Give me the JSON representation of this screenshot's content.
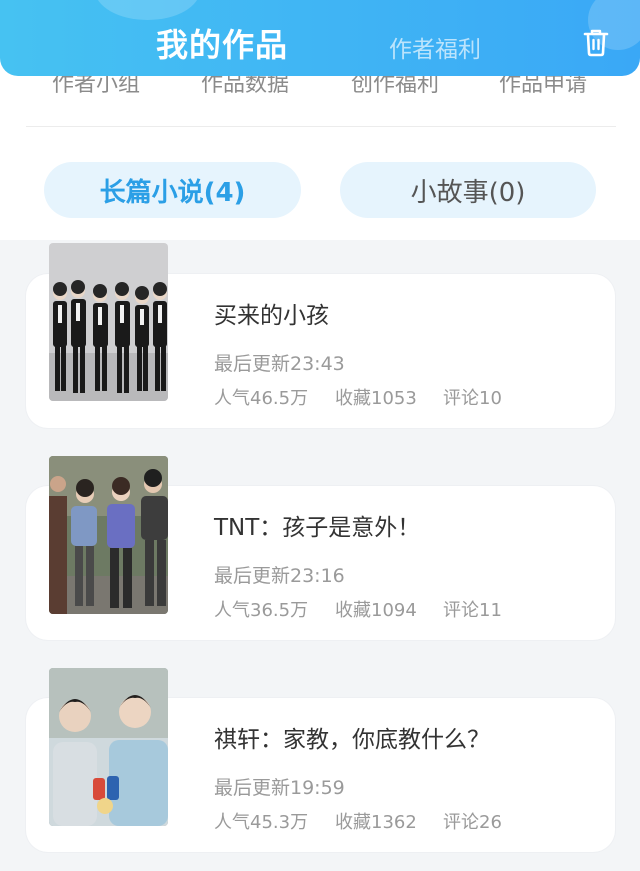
{
  "header": {
    "tab_active": "我的作品",
    "tab_inactive": "作者福利"
  },
  "submenu": [
    "作者小组",
    "作品数据",
    "创作福利",
    "作品申请"
  ],
  "tabs": {
    "long": "长篇小说(4)",
    "short": "小故事(0)"
  },
  "works": [
    {
      "title": "买来的小孩",
      "updated": "最后更新23:43",
      "popularity": "人气46.5万",
      "favorites": "收藏1053",
      "comments": "评论10"
    },
    {
      "title": "TNT：孩子是意外！",
      "updated": "最后更新23:16",
      "popularity": "人气36.5万",
      "favorites": "收藏1094",
      "comments": "评论11"
    },
    {
      "title": "祺轩：家教，你底教什么？",
      "updated": "最后更新19:59",
      "popularity": "人气45.3万",
      "favorites": "收藏1362",
      "comments": "评论26"
    }
  ],
  "icons": {
    "delete": "trash-icon"
  },
  "colors": {
    "header_start": "#46c2f2",
    "header_end": "#3aa8f6",
    "accent": "#2b9fe6"
  }
}
